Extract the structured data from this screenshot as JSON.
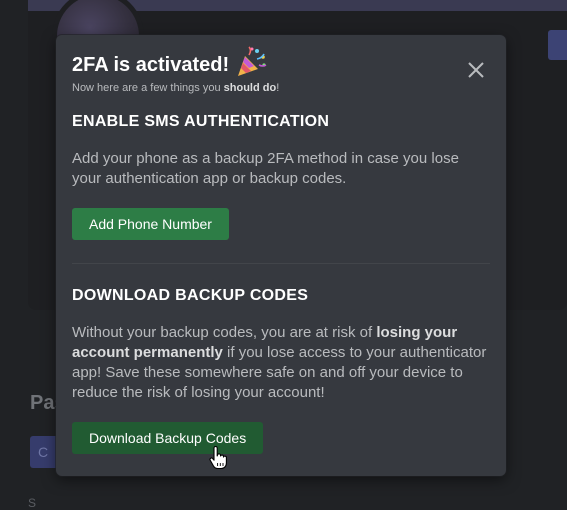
{
  "background": {
    "section_heading": "Pas",
    "button_label": "C",
    "small_text": "S"
  },
  "modal": {
    "title": "2FA is activated!",
    "title_icon": "party-popper-icon",
    "subtitle_prefix": "Now here are a few things you ",
    "subtitle_emphasis": "should do",
    "subtitle_suffix": "!",
    "close_icon": "close-icon",
    "sms": {
      "title": "ENABLE SMS AUTHENTICATION",
      "description": "Add your phone as a backup 2FA method in case you lose your authentication app or backup codes.",
      "button_label": "Add Phone Number"
    },
    "backup": {
      "title": "DOWNLOAD BACKUP CODES",
      "desc_part1": "Without your backup codes, you are at risk of ",
      "desc_bold": "losing your account permanently",
      "desc_part2": " if you lose access to your authenticator app! Save these somewhere safe on and off your device to reduce the risk of losing your account!",
      "button_label": "Download Backup Codes"
    }
  },
  "colors": {
    "modal_bg": "#36393f",
    "button_green": "#2d7d46",
    "button_green_hover": "#215b32",
    "page_bg": "#202225"
  }
}
